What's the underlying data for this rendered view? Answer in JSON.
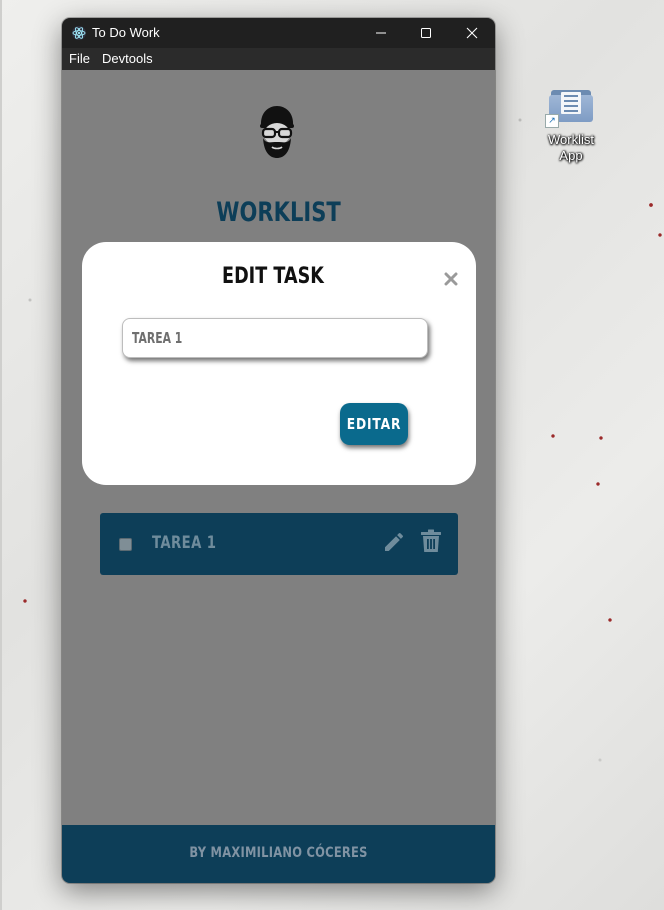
{
  "window": {
    "title": "To Do Work",
    "menu": [
      "File",
      "Devtools"
    ]
  },
  "app": {
    "title": "WORKLIST",
    "tasks": [
      {
        "name": "TAREA 1",
        "done": false
      }
    ],
    "footer": "BY MAXIMILIANO CÓCERES"
  },
  "modal": {
    "title": "EDIT TASK",
    "input_value": "TAREA 1",
    "button_label": "EDITAR"
  },
  "desktop": {
    "icon_label": "Worklist App"
  },
  "colors": {
    "brand": "#0d3e58",
    "button": "#0a6a8d",
    "overlay": "#808080",
    "titlebar": "#202020"
  },
  "icons": {
    "app": "electron-icon",
    "edit": "pencil-icon",
    "delete": "trash-icon",
    "close": "close-icon",
    "avatar": "bearded-man-avatar-icon"
  }
}
